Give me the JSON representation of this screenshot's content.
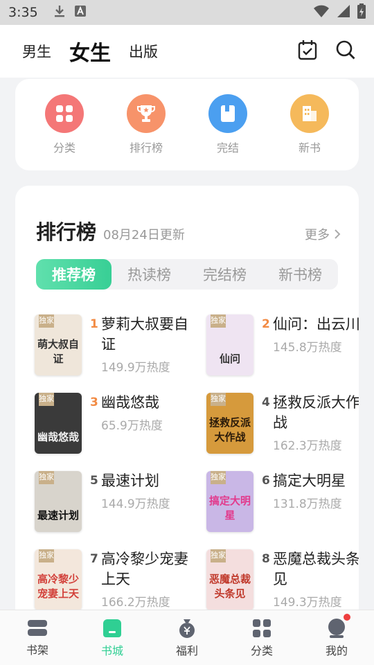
{
  "status": {
    "time": "3:35"
  },
  "topnav": {
    "tabs": [
      "男生",
      "女生",
      "出版"
    ]
  },
  "quick": [
    {
      "label": "分类",
      "color": "#f56e6e",
      "icon": "grid-icon"
    },
    {
      "label": "排行榜",
      "color": "#f7936a",
      "icon": "trophy-icon"
    },
    {
      "label": "完结",
      "color": "#4b9ff0",
      "icon": "book-icon"
    },
    {
      "label": "新书",
      "color": "#f5b95b",
      "icon": "building-icon"
    }
  ],
  "rank": {
    "title": "排行榜",
    "date": "08月24日更新",
    "more": "更多",
    "tabs": [
      "推荐榜",
      "热读榜",
      "完结榜",
      "新书榜"
    ],
    "badge": "独家",
    "books": [
      {
        "rank": "1",
        "name": "萝莉大叔要自证",
        "heat": "149.9万热度",
        "cover_title": "萌大叔自证",
        "cover_bg": "#efe6da",
        "cover_fg": "#333"
      },
      {
        "rank": "2",
        "name": "仙问：出云川",
        "heat": "145.8万热度",
        "cover_title": "仙问",
        "cover_bg": "#efe4f2",
        "cover_fg": "#333"
      },
      {
        "rank": "3",
        "name": "幽哉悠哉",
        "heat": "65.9万热度",
        "cover_title": "幽哉悠哉",
        "cover_bg": "#3a3a3a",
        "cover_fg": "#f0f0f0"
      },
      {
        "rank": "4",
        "name": "拯救反派大作战",
        "heat": "162.3万热度",
        "cover_title": "拯救反派大作战",
        "cover_bg": "#d69a3c",
        "cover_fg": "#2a1a0a"
      },
      {
        "rank": "5",
        "name": "最速计划",
        "heat": "144.9万热度",
        "cover_title": "最速计划",
        "cover_bg": "#d8d4cc",
        "cover_fg": "#111"
      },
      {
        "rank": "6",
        "name": "搞定大明星",
        "heat": "131.8万热度",
        "cover_title": "搞定大明星",
        "cover_bg": "#c9b7e6",
        "cover_fg": "#e23a8c"
      },
      {
        "rank": "7",
        "name": "高冷黎少宠妻上天",
        "heat": "166.2万热度",
        "cover_title": "高冷黎少宠妻上天",
        "cover_bg": "#f3e7dc",
        "cover_fg": "#d2403a"
      },
      {
        "rank": "8",
        "name": "恶魔总裁头条见",
        "heat": "149.3万热度",
        "cover_title": "恶魔总裁头条见",
        "cover_bg": "#f4dede",
        "cover_fg": "#c0392b"
      }
    ]
  },
  "bottomnav": [
    {
      "label": "书架",
      "icon": "bookshelf-icon"
    },
    {
      "label": "书城",
      "icon": "bookstore-icon"
    },
    {
      "label": "福利",
      "icon": "welfare-icon"
    },
    {
      "label": "分类",
      "icon": "category-icon"
    },
    {
      "label": "我的",
      "icon": "profile-icon"
    }
  ],
  "colors": {
    "accent": "#2fcf93",
    "rank_top": "#f28b44"
  }
}
